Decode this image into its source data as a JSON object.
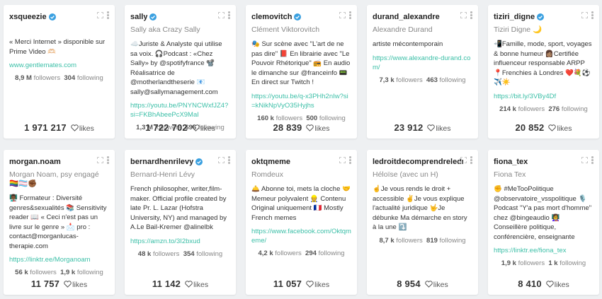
{
  "cards": [
    {
      "username": "xsqueezie",
      "verified": true,
      "fullname": "",
      "bio": "« Merci Internet » disponible sur Prime Video 🫶🏻",
      "link": "www.gentlemates.com",
      "followers": "8,9 M",
      "following": "304",
      "likes": "1 971 217"
    },
    {
      "username": "sally",
      "verified": true,
      "fullname": "Sally aka Crazy Sally",
      "bio": "☁️Juriste & Analyste qui utilise sa voix. 🎧Podcast : «Chez Sally» by @spotifyfrance 📽️Réalisatrice de @motherlandtheserie 📧 sally@sallymanagement.com",
      "link": "https://youtu.be/PNYNCWxfJZ4?si=FKBhAbeePcX9MaI",
      "followers": "1,3 M",
      "following": "696",
      "likes": "1 722 702"
    },
    {
      "username": "clemovitch",
      "verified": true,
      "fullname": "Clément Viktorovitch",
      "bio": "🎭 Sur scène avec \"L'art de ne pas dire\" 📕 En librairie avec \"Le Pouvoir Rhétorique\" 📻 En audio le dimanche sur @franceinfo 📟 En direct sur Twitch !",
      "link": "https://youtu.be/q-x3PHh2nIw?si=kNikNpVyO35Hyjhs",
      "followers": "160 k",
      "following": "500",
      "likes": "28 839"
    },
    {
      "username": "durand_alexandre",
      "verified": false,
      "fullname": "Alexandre Durand",
      "bio": "artiste mécontemporain",
      "link": "https://www.alexandre-durand.com/",
      "followers": "7,3 k",
      "following": "463",
      "likes": "23 912"
    },
    {
      "username": "tiziri_digne",
      "verified": true,
      "fullname": "Tiziri Digne 🌙",
      "bio": "📲Famille, mode, sport, voyages & bonne humeur 👩🏽Certifiée influenceur responsable ARPP 📍Frenchies à Londres ❤️💐⚽ ✈️☀️",
      "link": "https://bit.ly/3VBy4Df",
      "followers": "214 k",
      "following": "276",
      "likes": "20 852"
    },
    {
      "username": "morgan.noam",
      "verified": false,
      "fullname": "Morgan Noam, psy engagé 🏳️‍🌈🏳️‍⚧️✊🏾",
      "bio": "👨🏾‍🏫 Formateur : Diversité genres&sexualités 📚 Sensitivity reader 📖 « Ceci n'est pas un livre sur le genre » 📩 pro : contact@morganlucas-therapie.com",
      "link": "https://linktr.ee/Morganoam",
      "followers": "56 k",
      "following": "1,9 k",
      "likes": "11 757"
    },
    {
      "username": "bernardhenrilevy",
      "verified": true,
      "fullname": "Bernard-Henri Lévy",
      "bio": "French philosopher, writer,film-maker. Official profile created by late Pr. L. Lazar (Hofstra University, NY) and managed by A.Le Bail-Kremer @alinelbk",
      "link": "https://amzn.to/3I2bxud",
      "followers": "48 k",
      "following": "354",
      "likes": "11 142"
    },
    {
      "username": "oktqmeme",
      "verified": false,
      "fullname": "Romdeux",
      "bio": "🛎️ Abonne toi, mets la cloche 🤝 Memeur polyvalent 👷 Contenu Original uniquement 🇫🇷 Mostly French memes",
      "link": "https://www.facebook.com/Oktqmeme/",
      "followers": "4,2 k",
      "following": "294",
      "likes": "11 057"
    },
    {
      "username": "ledroitdecomprendreledroit",
      "verified": false,
      "fullname": "Héloïse (avec un H)",
      "bio": "☝️Je vous rends le droit + accessible ✌️Je vous explique l'actualité juridique 🤟Je débunke Ma démarche en story à la une ⤵️",
      "link": "",
      "followers": "8,7 k",
      "following": "819",
      "likes": "8 954"
    },
    {
      "username": "fiona_tex",
      "verified": false,
      "fullname": "Fiona Tex",
      "bio": "✊ #MeTooPolitique @observatoire_vsspolitique 🎙️ Podcast \"Y'a pas mort d'homme\" chez @bingeaudio 👩‍🏫 Conseillère politique, conférencière, enseignante",
      "link": "https://linktr.ee/fiona_tex",
      "followers": "1,9 k",
      "following": "1 k",
      "likes": "8 410"
    }
  ],
  "labels": {
    "followers": "followers",
    "following": "following",
    "likes": "likes"
  },
  "colors": {
    "link": "#3bbfa7",
    "verified": "#3aa0e0",
    "background": "#eef0f2"
  }
}
